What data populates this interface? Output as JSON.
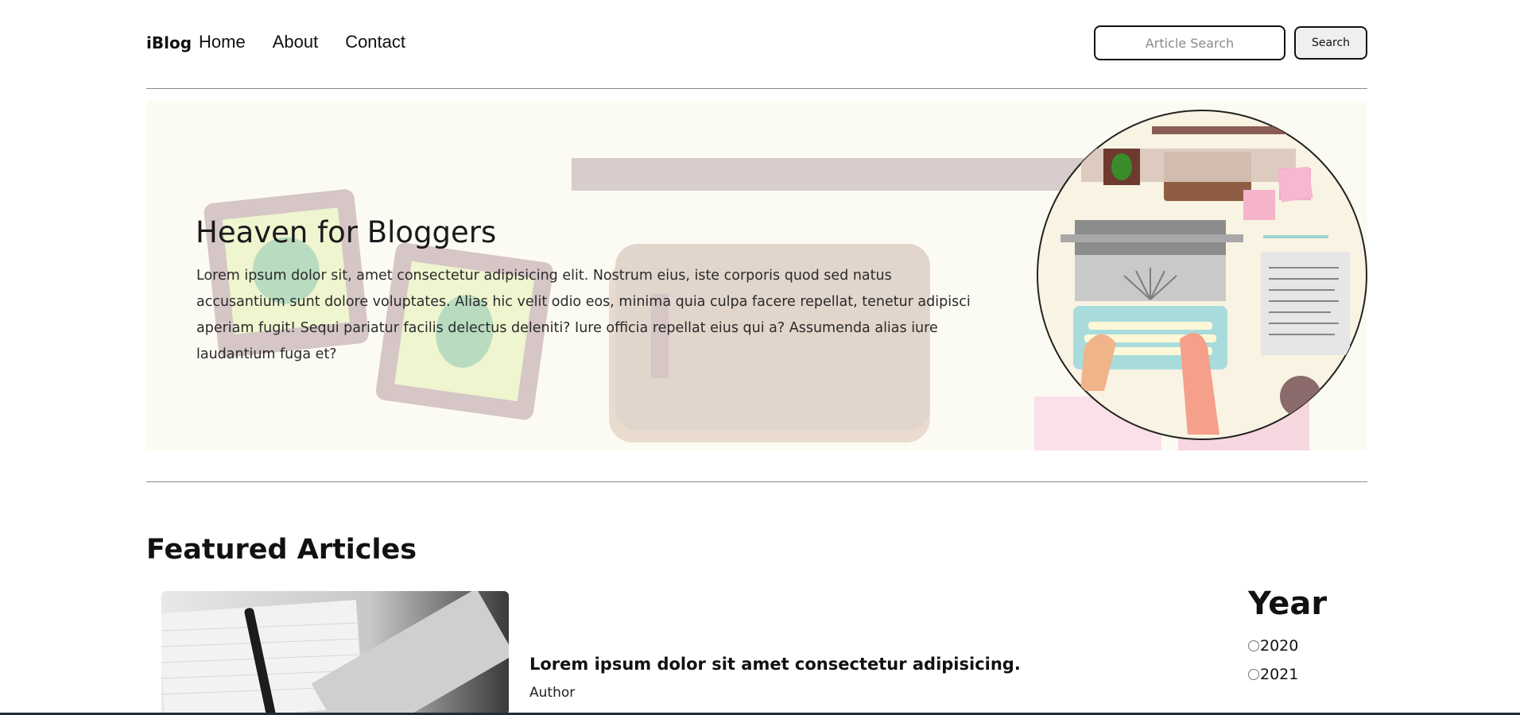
{
  "nav": {
    "brand": "iBlog",
    "links": [
      "Home",
      "About",
      "Contact"
    ],
    "search_placeholder": "Article Search",
    "search_button": "Search"
  },
  "hero": {
    "title": "Heaven for Bloggers",
    "text": "Lorem ipsum dolor sit, amet consectetur adipisicing elit. Nostrum eius, iste corporis quod sed natus accusantium sunt dolore voluptates. Alias hic velit odio eos, minima quia culpa facere repellat, tenetur adipisci aperiam fugit! Sequi pariatur facilis delectus deleniti? Iure officia repellat eius qui a? Assumenda alias iure laudantium fuga et?"
  },
  "featured": {
    "heading": "Featured Articles",
    "articles": [
      {
        "title": "Lorem ipsum dolor sit amet consectetur adipisicing.",
        "author": "Author"
      }
    ]
  },
  "filter": {
    "heading": "Year",
    "years": [
      "2020",
      "2021"
    ]
  },
  "colors": {
    "hero_bg": "#fcfbf3",
    "accent_mauve": "#d6c8c8",
    "divider": "#8a8a8a"
  }
}
